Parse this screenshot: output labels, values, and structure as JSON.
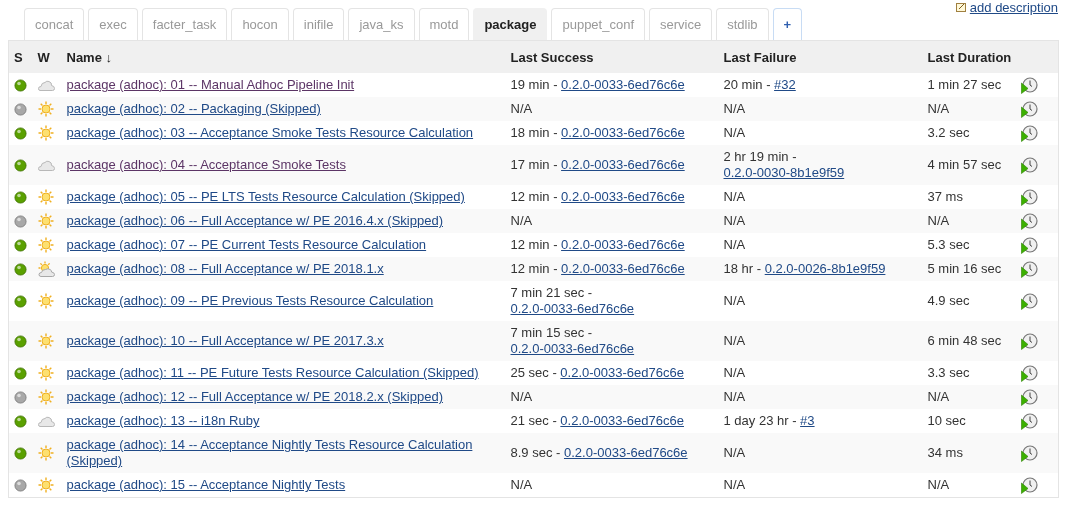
{
  "top_link": {
    "label": "add description"
  },
  "tabs": [
    {
      "label": "concat",
      "selected": false,
      "kind": "view"
    },
    {
      "label": "exec",
      "selected": false,
      "kind": "view"
    },
    {
      "label": "facter_task",
      "selected": false,
      "kind": "view"
    },
    {
      "label": "hocon",
      "selected": false,
      "kind": "view"
    },
    {
      "label": "inifile",
      "selected": false,
      "kind": "view"
    },
    {
      "label": "java_ks",
      "selected": false,
      "kind": "view"
    },
    {
      "label": "motd",
      "selected": false,
      "kind": "view"
    },
    {
      "label": "package",
      "selected": true,
      "kind": "view"
    },
    {
      "label": "puppet_conf",
      "selected": false,
      "kind": "view"
    },
    {
      "label": "service",
      "selected": false,
      "kind": "view"
    },
    {
      "label": "stdlib",
      "selected": false,
      "kind": "view"
    },
    {
      "label": "+",
      "selected": false,
      "kind": "add"
    }
  ],
  "table": {
    "columns": [
      {
        "label": "S"
      },
      {
        "label": "W"
      },
      {
        "label": "Name",
        "sort_arrow": "↓"
      },
      {
        "label": "Last Success"
      },
      {
        "label": "Last Failure"
      },
      {
        "label": "Last Duration"
      }
    ],
    "rows": [
      {
        "color": "#5aa000",
        "kind": "cloudy",
        "name": "package (adhoc): 01 -- Manual Adhoc Pipeline Init",
        "visited": true,
        "last_success": {
          "time": "19 min - ",
          "build": "0.2.0-0033-6ed76c6e"
        },
        "last_failure": {
          "time": "20 min - ",
          "build": "#32"
        },
        "last_duration": "1 min 27 sec"
      },
      {
        "color": "#a8a8a8",
        "kind": "sunny",
        "name": "package (adhoc): 02 -- Packaging (Skipped)",
        "visited": false,
        "last_success": {
          "time": "N/A"
        },
        "last_failure": {
          "time": "N/A"
        },
        "last_duration": "N/A"
      },
      {
        "color": "#5aa000",
        "kind": "sunny",
        "name": "package (adhoc): 03 -- Acceptance Smoke Tests Resource Calculation",
        "visited": false,
        "last_success": {
          "time": "18 min - ",
          "build": "0.2.0-0033-6ed76c6e"
        },
        "last_failure": {
          "time": "N/A"
        },
        "last_duration": "3.2 sec"
      },
      {
        "color": "#5aa000",
        "kind": "cloudy",
        "name": "package (adhoc): 04 -- Acceptance Smoke Tests",
        "visited": true,
        "last_success": {
          "time": "17 min - ",
          "build": "0.2.0-0033-6ed76c6e"
        },
        "last_failure": {
          "time": "2 hr 19 min - ",
          "build": "0.2.0-0030-8b1e9f59"
        },
        "last_duration": "4 min 57 sec"
      },
      {
        "color": "#5aa000",
        "kind": "sunny",
        "name": "package (adhoc): 05 -- PE LTS Tests Resource Calculation (Skipped)",
        "visited": false,
        "last_success": {
          "time": "12 min - ",
          "build": "0.2.0-0033-6ed76c6e"
        },
        "last_failure": {
          "time": "N/A"
        },
        "last_duration": "37 ms"
      },
      {
        "color": "#a8a8a8",
        "kind": "sunny",
        "name": "package (adhoc): 06 -- Full Acceptance w/ PE 2016.4.x (Skipped)",
        "visited": false,
        "last_success": {
          "time": "N/A"
        },
        "last_failure": {
          "time": "N/A"
        },
        "last_duration": "N/A"
      },
      {
        "color": "#5aa000",
        "kind": "sunny",
        "name": "package (adhoc): 07 -- PE Current Tests Resource Calculation",
        "visited": false,
        "last_success": {
          "time": "12 min - ",
          "build": "0.2.0-0033-6ed76c6e"
        },
        "last_failure": {
          "time": "N/A"
        },
        "last_duration": "5.3 sec"
      },
      {
        "color": "#5aa000",
        "kind": "overcast",
        "name": "package (adhoc): 08 -- Full Acceptance w/ PE 2018.1.x",
        "visited": false,
        "last_success": {
          "time": "12 min - ",
          "build": "0.2.0-0033-6ed76c6e"
        },
        "last_failure": {
          "time": "18 hr - ",
          "build": "0.2.0-0026-8b1e9f59"
        },
        "last_duration": "5 min 16 sec"
      },
      {
        "color": "#5aa000",
        "kind": "sunny",
        "name": "package (adhoc): 09 -- PE Previous Tests Resource Calculation",
        "visited": false,
        "last_success": {
          "time": "7 min 21 sec - ",
          "build": "0.2.0-0033-6ed76c6e"
        },
        "last_failure": {
          "time": "N/A"
        },
        "last_duration": "4.9 sec"
      },
      {
        "color": "#5aa000",
        "kind": "sunny",
        "name": "package (adhoc): 10 -- Full Acceptance w/ PE 2017.3.x",
        "visited": false,
        "last_success": {
          "time": "7 min 15 sec - ",
          "build": "0.2.0-0033-6ed76c6e"
        },
        "last_failure": {
          "time": "N/A"
        },
        "last_duration": "6 min 48 sec"
      },
      {
        "color": "#5aa000",
        "kind": "sunny",
        "name": "package (adhoc): 11 -- PE Future Tests Resource Calculation (Skipped)",
        "visited": false,
        "last_success": {
          "time": "25 sec - ",
          "build": "0.2.0-0033-6ed76c6e"
        },
        "last_failure": {
          "time": "N/A"
        },
        "last_duration": "3.3 sec"
      },
      {
        "color": "#a8a8a8",
        "kind": "sunny",
        "name": "package (adhoc): 12 -- Full Acceptance w/ PE 2018.2.x (Skipped)",
        "visited": false,
        "last_success": {
          "time": "N/A"
        },
        "last_failure": {
          "time": "N/A"
        },
        "last_duration": "N/A"
      },
      {
        "color": "#5aa000",
        "kind": "cloudy",
        "name": "package (adhoc): 13 -- i18n Ruby",
        "visited": false,
        "last_success": {
          "time": "21 sec - ",
          "build": "0.2.0-0033-6ed76c6e"
        },
        "last_failure": {
          "time": "1 day 23 hr - ",
          "build": "#3"
        },
        "last_duration": "10 sec"
      },
      {
        "color": "#5aa000",
        "kind": "sunny",
        "name": "package (adhoc): 14 -- Acceptance Nightly Tests Resource Calculation (Skipped)",
        "visited": false,
        "last_success": {
          "time": "8.9 sec - ",
          "build": "0.2.0-0033-6ed76c6e"
        },
        "last_failure": {
          "time": "N/A"
        },
        "last_duration": "34 ms"
      },
      {
        "color": "#a8a8a8",
        "kind": "sunny",
        "name": "package (adhoc): 15 -- Acceptance Nightly Tests",
        "visited": false,
        "last_success": {
          "time": "N/A"
        },
        "last_failure": {
          "time": "N/A"
        },
        "last_duration": "N/A"
      }
    ]
  }
}
